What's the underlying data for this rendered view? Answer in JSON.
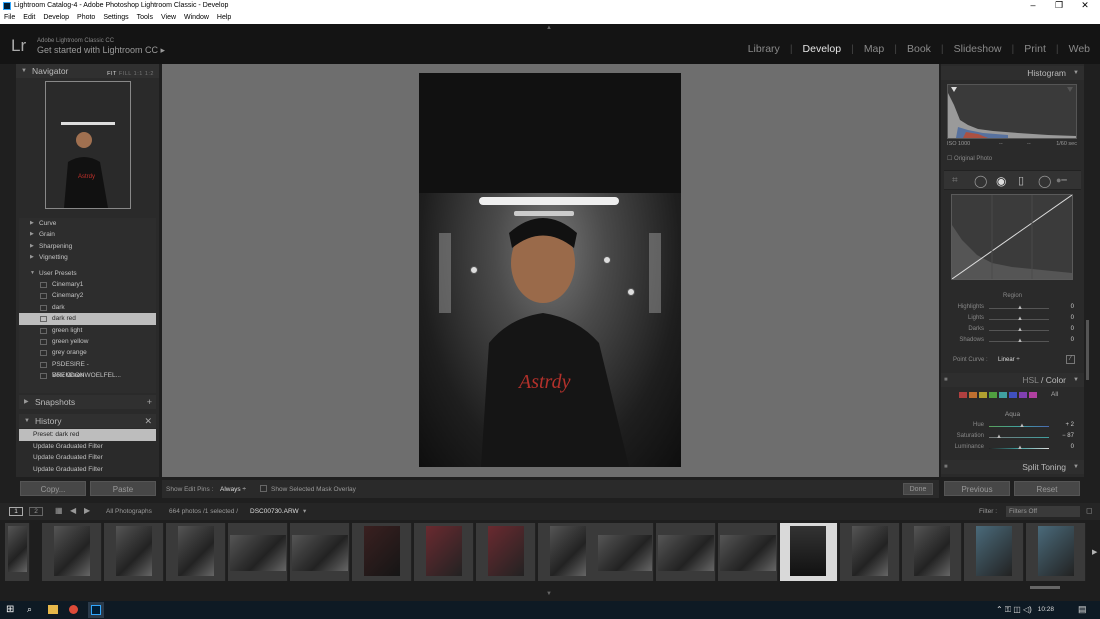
{
  "window": {
    "title": "Lightroom Catalog-4 - Adobe Photoshop Lightroom Classic - Develop",
    "minimize": "–",
    "maximize": "❐",
    "close": "✕"
  },
  "menu": [
    "File",
    "Edit",
    "Develop",
    "Photo",
    "Settings",
    "Tools",
    "View",
    "Window",
    "Help"
  ],
  "identity": {
    "logo": "Lr",
    "line1": "Adobe Lightroom Classic CC",
    "line2": "Get started with Lightroom CC ▸"
  },
  "modules": [
    "Library",
    "Develop",
    "Map",
    "Book",
    "Slideshow",
    "Print",
    "Web"
  ],
  "active_module": "Develop",
  "navigator": {
    "title": "Navigator",
    "opts": [
      "FIT",
      "FILL",
      "1:1",
      "1:2"
    ]
  },
  "presets": [
    {
      "label": "Curve",
      "type": "folder"
    },
    {
      "label": "Grain",
      "type": "folder"
    },
    {
      "label": "Sharpening",
      "type": "folder"
    },
    {
      "label": "Vignetting",
      "type": "folder"
    },
    {
      "label": "User Presets",
      "type": "folder-open"
    },
    {
      "label": "Cinemary1",
      "type": "child"
    },
    {
      "label": "Cinemary2",
      "type": "child"
    },
    {
      "label": "dark",
      "type": "child"
    },
    {
      "label": "dark red",
      "type": "child",
      "selected": true
    },
    {
      "label": "green light",
      "type": "child"
    },
    {
      "label": "green yellow",
      "type": "child"
    },
    {
      "label": "grey orange",
      "type": "child"
    },
    {
      "label": "PSDESIRE - BRENDONWOELFEL...",
      "type": "child"
    },
    {
      "label": "Volk Green",
      "type": "child"
    }
  ],
  "snapshots": {
    "title": "Snapshots"
  },
  "history": {
    "title": "History",
    "items": [
      {
        "label": "Preset: dark red",
        "selected": true
      },
      {
        "label": "Update Graduated Filter"
      },
      {
        "label": "Update Graduated Filter"
      },
      {
        "label": "Update Graduated Filter"
      }
    ]
  },
  "buttons": {
    "copy": "Copy...",
    "paste": "Paste",
    "previous": "Previous",
    "reset": "Reset",
    "done": "Done"
  },
  "toolbar": {
    "show_edit_pins_label": "Show Edit Pins :",
    "show_edit_pins_value": "Always ÷",
    "overlay_label": "Show Selected Mask Overlay"
  },
  "histogram": {
    "title": "Histogram",
    "iso": "ISO 1000",
    "dash1": "--",
    "dash2": "--",
    "shutter": "1/60 sec",
    "original": "Original Photo"
  },
  "curve": {
    "region": "Region",
    "sliders": [
      {
        "label": "Highlights",
        "value": "0"
      },
      {
        "label": "Lights",
        "value": "0"
      },
      {
        "label": "Darks",
        "value": "0"
      },
      {
        "label": "Shadows",
        "value": "0"
      }
    ],
    "point_curve_label": "Point Curve :",
    "point_curve_value": "Linear ÷"
  },
  "hsl": {
    "title_hsl": "HSL",
    "sep": " / ",
    "title_color": "Color",
    "all": "All",
    "channel": "Aqua",
    "sliders": [
      {
        "label": "Hue",
        "value": "+ 2"
      },
      {
        "label": "Saturation",
        "value": "− 87"
      },
      {
        "label": "Luminance",
        "value": "0"
      }
    ]
  },
  "split_toning": {
    "title": "Split Toning"
  },
  "swatch_colors": [
    "#b04040",
    "#c07030",
    "#b0a030",
    "#50a040",
    "#40a0a0",
    "#4050c0",
    "#8040b0",
    "#b040a0"
  ],
  "filmstrip": {
    "page1": "1",
    "page2": "2",
    "source": "All Photographs",
    "count": "664 photos /1 selected /",
    "filename": "DSC00730.ARW",
    "filter_label": "Filter :",
    "filter_value": "Filters Off"
  },
  "taskbar": {
    "time": "10:28"
  }
}
